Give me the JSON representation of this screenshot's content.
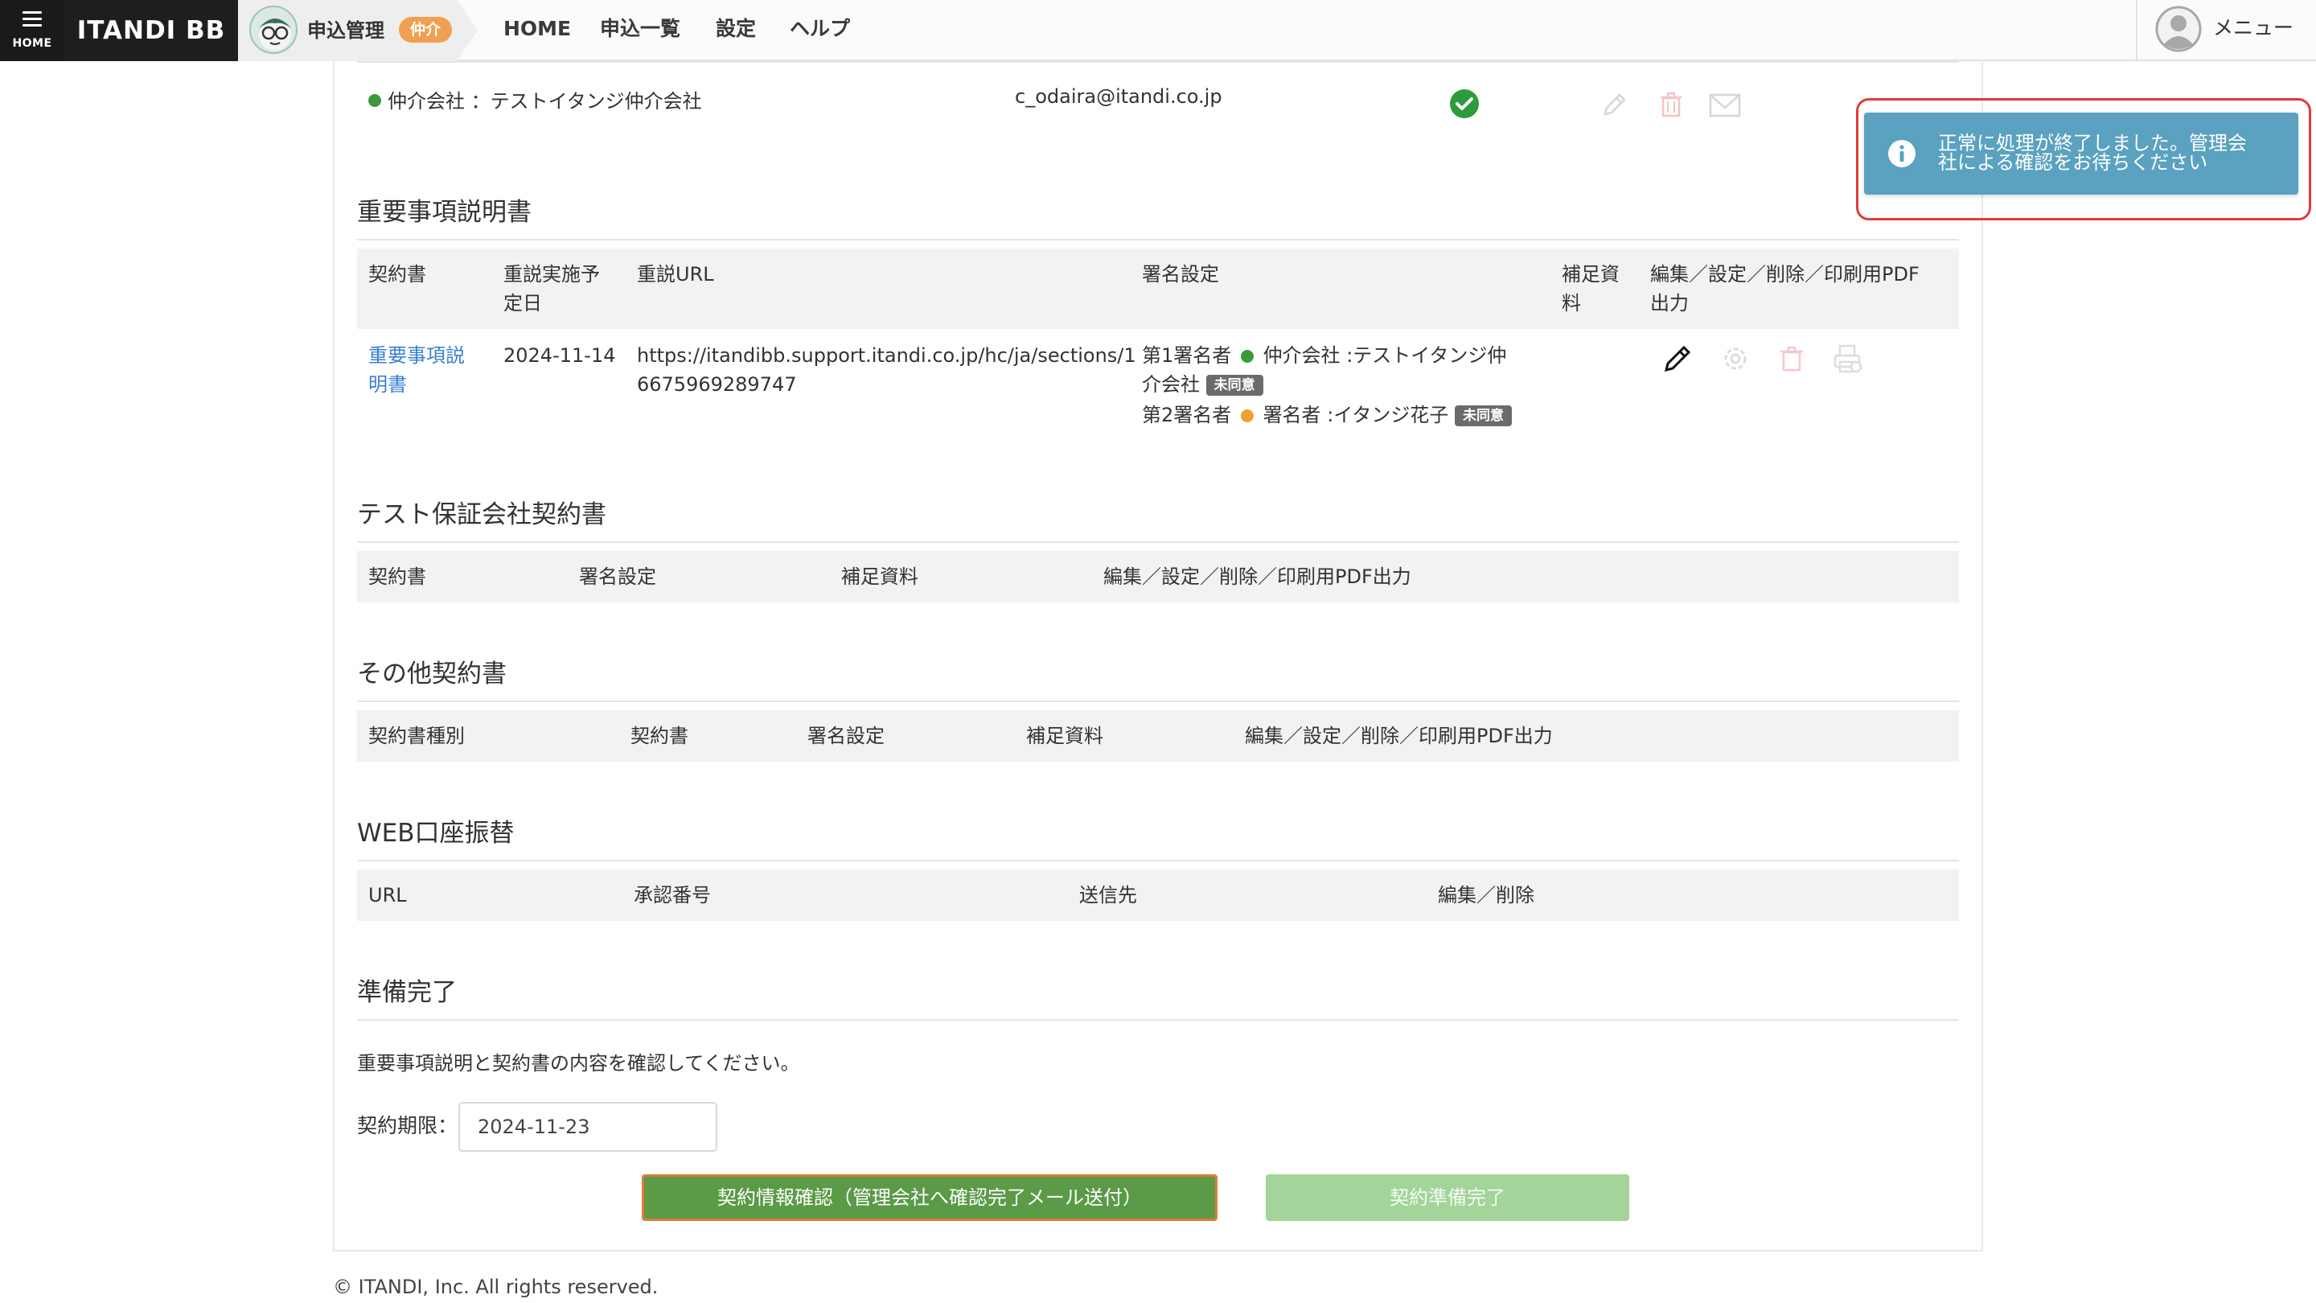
{
  "header": {
    "home_label": "HOME",
    "brand": "ITANDI BB",
    "app_title": "申込管理",
    "app_badge": "仲介",
    "nav": [
      "HOME",
      "申込一覧",
      "設定",
      "ヘルプ"
    ],
    "menu_label": "メニュー"
  },
  "agent_row": {
    "name": "仲介会社 ：テストイタンジ仲介会社",
    "email": "c_odaira@itandi.co.jp"
  },
  "important_section": {
    "title": "重要事項説明書",
    "headers": {
      "contract_l1": "契約書",
      "date_l1": "重説実施予",
      "date_l2": "定日",
      "url": "重説URL",
      "signature": "署名設定",
      "supplement_l1": "補足資",
      "supplement_l2": "料",
      "actions_l1": "編集／設定／削除／印刷用PDF",
      "actions_l2": "出力"
    },
    "row": {
      "doc_link_l1": "重要事項説",
      "doc_link_l2": "明書",
      "date": "2024-11-14",
      "url_l1": "https://itandibb.support.itandi.co.jp/hc/ja/sections/1",
      "url_l2": "6675969289747",
      "signer1_prefix": "第1署名者",
      "signer1_text_l1": "仲介会社 :テストイタンジ仲",
      "signer1_text_l2": "介会社",
      "signer1_status": "未同意",
      "signer2_prefix": "第2署名者",
      "signer2_text": "署名者 :イタンジ花子",
      "signer2_status": "未同意"
    }
  },
  "guarantee_section": {
    "title": "テスト保証会社契約書",
    "headers": [
      "契約書",
      "署名設定",
      "補足資料",
      "編集／設定／削除／印刷用PDF出力"
    ]
  },
  "other_section": {
    "title": "その他契約書",
    "headers": [
      "契約書種別",
      "契約書",
      "署名設定",
      "補足資料",
      "編集／設定／削除／印刷用PDF出力"
    ]
  },
  "web_section": {
    "title": "WEB口座振替",
    "headers": [
      "URL",
      "承認番号",
      "送信先",
      "編集／削除"
    ]
  },
  "ready_section": {
    "title": "準備完了",
    "instruction": "重要事項説明と契約書の内容を確認してください。",
    "deadline_label": "契約期限：",
    "deadline_value": "2024-11-23",
    "confirm_button": "契約情報確認（管理会社へ確認完了メール送付）",
    "done_button": "契約準備完了"
  },
  "footer": "© ITANDI, Inc. All rights reserved.",
  "toast": {
    "line1": "正常に処理が終了しました。管理会",
    "line2": "社による確認をお待ちください"
  },
  "colors": {
    "toast_bg": "#5aa2c0",
    "highlight": "#e03a3a",
    "confirm_green": "#5b9a47",
    "done_green_disabled": "#a3d49a",
    "link": "#3a7fd0",
    "badge_orange": "#f0a050"
  }
}
